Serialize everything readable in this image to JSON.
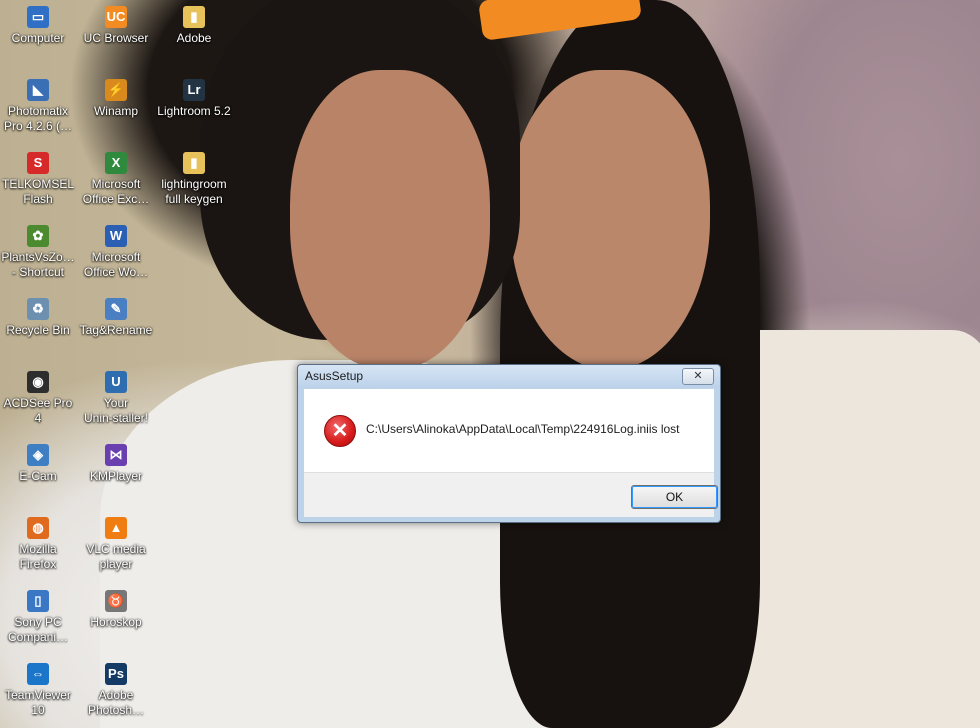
{
  "desktop": {
    "icons": [
      {
        "label": "Computer",
        "icon": "computer-icon",
        "glyph": "▭",
        "color": "#2f6fc6"
      },
      {
        "label": "UC Browser",
        "icon": "uc-browser-icon",
        "glyph": "UC",
        "color": "#f28b22"
      },
      {
        "label": "Adobe",
        "icon": "folder-icon",
        "glyph": "▮",
        "color": "#e7c15a"
      },
      {
        "label": "Photomatix\nPro 4.2.6 (…",
        "icon": "photomatix-icon",
        "glyph": "◣",
        "color": "#3b6fb5"
      },
      {
        "label": "Winamp",
        "icon": "winamp-icon",
        "glyph": "⚡",
        "color": "#d98a1c"
      },
      {
        "label": "Lightroom 5.2",
        "icon": "lightroom-icon",
        "glyph": "Lr",
        "color": "#223344"
      },
      {
        "label": "TELKOMSEL\nFlash",
        "icon": "telkomsel-flash-icon",
        "glyph": "S",
        "color": "#d62a2a"
      },
      {
        "label": "Microsoft\nOffice Exc…",
        "icon": "excel-icon",
        "glyph": "X",
        "color": "#2f8a3e"
      },
      {
        "label": "lightingroom\nfull keygen",
        "icon": "folder-icon",
        "glyph": "▮",
        "color": "#e7c15a"
      },
      {
        "label": "PlantsVsZo…\n- Shortcut",
        "icon": "plants-vs-zombies-icon",
        "glyph": "✿",
        "color": "#4c8a2f"
      },
      {
        "label": "Microsoft\nOffice Wo…",
        "icon": "word-icon",
        "glyph": "W",
        "color": "#2b5fb4"
      },
      {
        "label": "Recycle Bin",
        "icon": "recycle-bin-icon",
        "glyph": "♻",
        "color": "#6d8fb0"
      },
      {
        "label": "Tag&Rename",
        "icon": "tag-rename-icon",
        "glyph": "✎",
        "color": "#4a7fc1"
      },
      {
        "label": "ACDSee Pro 4",
        "icon": "acdsee-icon",
        "glyph": "◉",
        "color": "#2d2d2d"
      },
      {
        "label": "Your\nUnin-staller!",
        "icon": "uninstaller-icon",
        "glyph": "U",
        "color": "#2e6db0"
      },
      {
        "label": "E-Cam",
        "icon": "ecam-icon",
        "glyph": "◈",
        "color": "#3d7fc2"
      },
      {
        "label": "KMPlayer",
        "icon": "kmplayer-icon",
        "glyph": "⋈",
        "color": "#6a3fb0"
      },
      {
        "label": "Mozilla\nFirefox",
        "icon": "firefox-icon",
        "glyph": "◍",
        "color": "#e06b1e"
      },
      {
        "label": "VLC media\nplayer",
        "icon": "vlc-icon",
        "glyph": "▲",
        "color": "#ef7d12"
      },
      {
        "label": "Sony PC\nCompani…",
        "icon": "sony-pc-companion-icon",
        "glyph": "▯",
        "color": "#3a78c6"
      },
      {
        "label": "Horoskop",
        "icon": "horoskop-icon",
        "glyph": "♉",
        "color": "#777777"
      },
      {
        "label": "TeamViewer\n10",
        "icon": "teamviewer-icon",
        "glyph": "⇔",
        "color": "#1b76c9"
      },
      {
        "label": "Adobe\nPhotosh…",
        "icon": "photoshop-icon",
        "glyph": "Ps",
        "color": "#143a66"
      }
    ]
  },
  "dialog": {
    "title": "AsusSetup",
    "message": "C:\\Users\\Alinoka\\AppData\\Local\\Temp\\224916Log.iniis lost",
    "ok_label": "OK",
    "close_glyph": "✕",
    "error_glyph": "✕"
  }
}
